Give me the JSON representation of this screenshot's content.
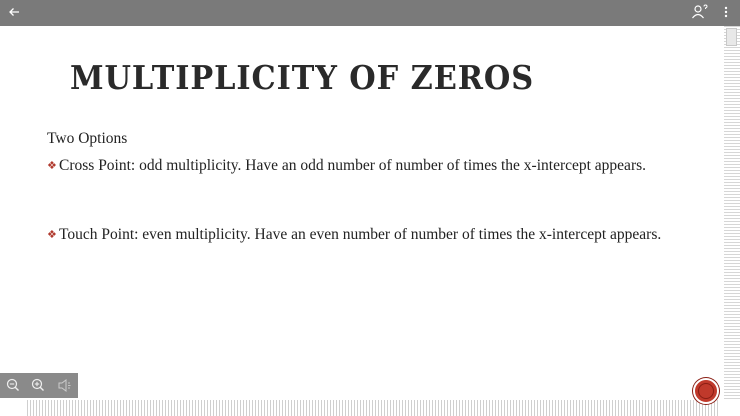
{
  "toolbar": {
    "back_icon": "arrow-left-icon",
    "person_icon": "person-question-icon",
    "more_icon": "more-vertical-icon"
  },
  "slide": {
    "title": "MULTIPLICITY OF ZEROS",
    "subheading": "Two Options",
    "bullets": [
      {
        "text": "Cross Point: odd multiplicity. Have an odd number of number of times the x-intercept appears."
      },
      {
        "text": "Touch Point: even multiplicity. Have an even number of number of times the x-intercept appears."
      }
    ],
    "bullet_marker": "❖"
  },
  "controls": {
    "zoom_out_icon": "zoom-out-icon",
    "zoom_in_icon": "zoom-in-icon",
    "speaker_icon": "speaker-icon",
    "record_icon": "record-icon"
  },
  "colors": {
    "toolbar": "#7a7a7a",
    "bullet_marker": "#b03a2e",
    "record": "#c0392b"
  }
}
